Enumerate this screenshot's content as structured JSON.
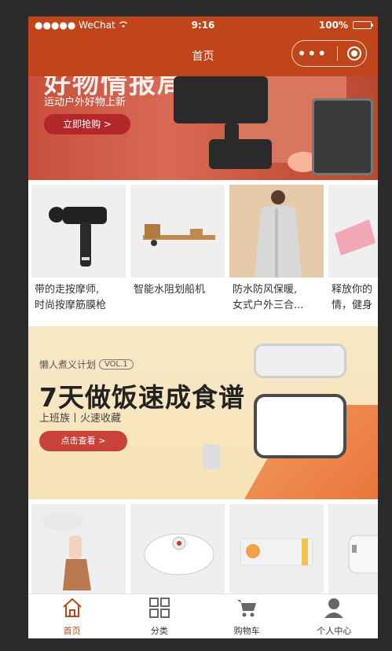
{
  "statusbar": {
    "carrier": "●●●●● WeChat",
    "time": "9:16",
    "battery": "100%"
  },
  "navbar": {
    "title": "首页",
    "capsule_more_icon": "more-dots-icon",
    "capsule_close_icon": "target-icon"
  },
  "banner_top": {
    "subtitle": "运动户外好物上新",
    "button": "立即抢购 >",
    "headline_partial": "好物情报局"
  },
  "products_row1": [
    {
      "name_line1": "带的走按摩师,",
      "name_line2": "时尚按摩筋膜枪"
    },
    {
      "name_line1": "智能水阻划船机",
      "name_line2": ""
    },
    {
      "name_line1": "防水防风保暖,",
      "name_line2": "女式户外三合..."
    },
    {
      "name_line1": "释放你的",
      "name_line2": "情，健身"
    }
  ],
  "banner_cook": {
    "plan": "懒人煮义计划",
    "vol": "VOL.1",
    "title": "7天做饭速成食谱",
    "subtitle": "上班族丨火速收藏",
    "button": "点击查看 >"
  },
  "tabbar": [
    {
      "label": "首页",
      "icon": "home-icon",
      "active": true
    },
    {
      "label": "分类",
      "icon": "grid-icon",
      "active": false
    },
    {
      "label": "购物车",
      "icon": "cart-icon",
      "active": false
    },
    {
      "label": "个人中心",
      "icon": "user-icon",
      "active": false
    }
  ],
  "colors": {
    "brand": "#c0451b",
    "accent_red": "#b3262a",
    "cook_bg": "#f7e8c6"
  }
}
